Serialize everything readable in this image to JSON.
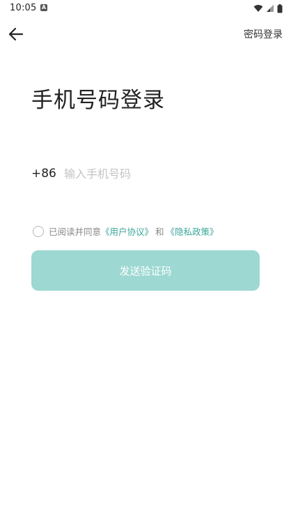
{
  "status_bar": {
    "time": "10:05",
    "app_icon_letter": "A",
    "icons": [
      "wifi-icon",
      "signal-icon",
      "battery-icon"
    ]
  },
  "header": {
    "back_icon": "arrow-left-icon",
    "password_login_label": "密码登录"
  },
  "title": "手机号码登录",
  "phone": {
    "country_code": "+86",
    "placeholder": "输入手机号码",
    "value": ""
  },
  "agreement": {
    "prefix": "已阅读并同意",
    "user_agreement": "《用户协议》",
    "and": "和",
    "privacy_policy": "《隐私政策》",
    "checked": false
  },
  "send_button": {
    "label": "发送验证码",
    "enabled": false
  },
  "colors": {
    "accent": "#3aa69a",
    "button_disabled": "#9dd8d2",
    "text": "#222222",
    "muted": "#888888"
  }
}
